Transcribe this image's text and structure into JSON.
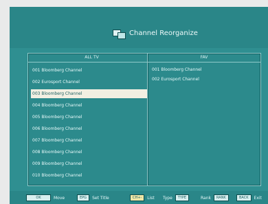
{
  "title": {
    "text": "Channel Reorganize"
  },
  "left_panel": {
    "header": "ALL TV",
    "channels": [
      "001 Bloomberg Channel",
      "002 Eurosport Channel",
      "003 Bloomberg Channel",
      "004 Bloomberg Channel",
      "005 Bloomberg Channel",
      "006 Bloomberg Channel",
      "007 Bloomberg Channel",
      "008 Bloomberg Channel",
      "009 Bloomberg Channel",
      "010 Bloomberg Channel"
    ],
    "selected_index": 2
  },
  "right_panel": {
    "header": "FAV",
    "channels": [
      "001 Bloomberg Channel",
      "002 Eurosport Channel"
    ]
  },
  "footer": {
    "items": [
      {
        "key": "OK",
        "label": "Move"
      },
      {
        "key": "EPG",
        "label": "Set Title"
      },
      {
        "key": "CH+-",
        "label": "List"
      },
      {
        "key": "TYPE",
        "label": "Type"
      },
      {
        "key": "RANK",
        "label": "Rank"
      },
      {
        "key": "BACK",
        "label": "Exit"
      }
    ]
  }
}
